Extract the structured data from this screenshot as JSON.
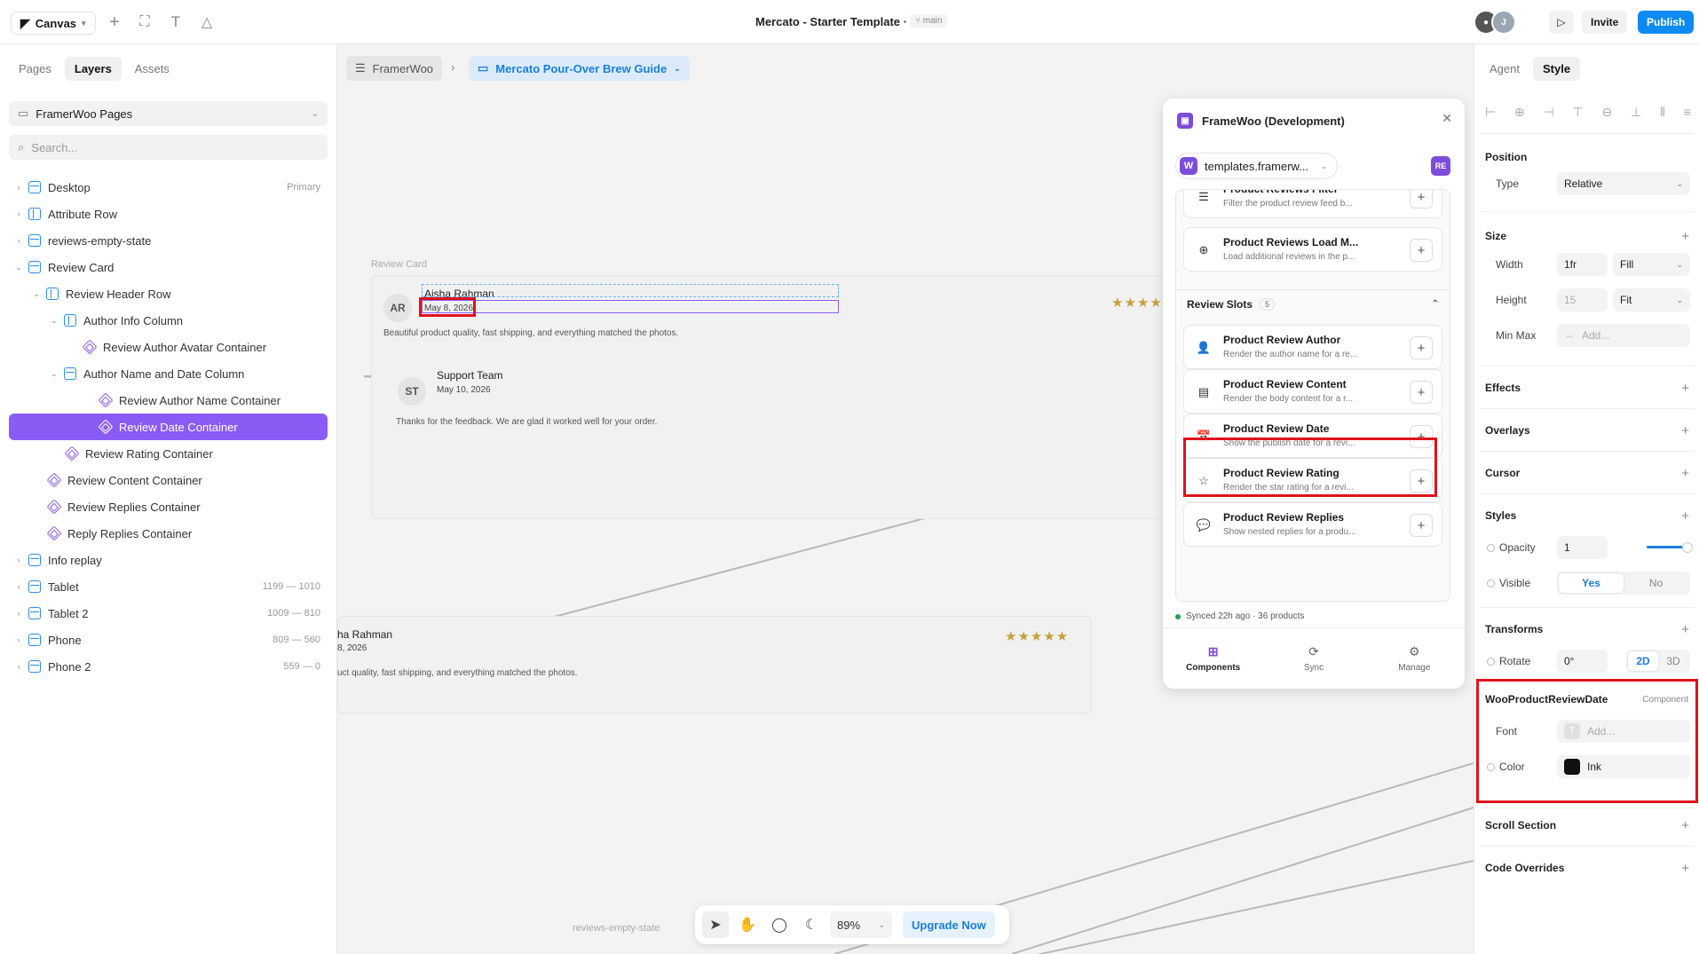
{
  "topbar": {
    "canvas_label": "Canvas",
    "title": "Mercato - Starter Template",
    "separator": "·",
    "branch": "main",
    "avatar_initial": "J",
    "invite_label": "Invite",
    "publish_label": "Publish",
    "colors": {
      "publish": "#0e8bf1"
    }
  },
  "left": {
    "tabs": [
      "Pages",
      "Layers",
      "Assets"
    ],
    "active_tab": "Layers",
    "page_select": "FramerWoo Pages",
    "search_placeholder": "Search...",
    "tree": [
      {
        "label": "Desktop",
        "meta": "Primary",
        "icon": "frame-icon",
        "caret": "›"
      },
      {
        "label": "Attribute Row",
        "meta": "",
        "icon": "column-icon",
        "caret": "›"
      },
      {
        "label": "reviews-empty-state",
        "meta": "",
        "icon": "frame-icon",
        "caret": "›"
      },
      {
        "label": "Review Card",
        "meta": "",
        "icon": "frame-icon",
        "caret": "⌄"
      },
      {
        "label": "Review Header Row",
        "meta": "",
        "icon": "column-icon",
        "caret": "⌄"
      },
      {
        "label": "Author Info Column",
        "meta": "",
        "icon": "column-icon",
        "caret": "⌄"
      },
      {
        "label": "Review Author Avatar Container",
        "meta": "",
        "icon": "component-icon",
        "caret": ""
      },
      {
        "label": "Author Name and Date Column",
        "meta": "",
        "icon": "frame-icon",
        "caret": "⌄"
      },
      {
        "label": "Review Author Name Container",
        "meta": "",
        "icon": "component-icon",
        "caret": ""
      },
      {
        "label": "Review Date Container",
        "meta": "",
        "icon": "component-icon",
        "caret": ""
      },
      {
        "label": "Review Rating Container",
        "meta": "",
        "icon": "component-icon",
        "caret": ""
      },
      {
        "label": "Review Content Container",
        "meta": "",
        "icon": "component-icon",
        "caret": ""
      },
      {
        "label": "Review Replies Container",
        "meta": "",
        "icon": "component-icon",
        "caret": ""
      },
      {
        "label": "Reply Replies Container",
        "meta": "",
        "icon": "component-icon",
        "caret": ""
      },
      {
        "label": "Info replay",
        "meta": "",
        "icon": "frame-icon",
        "caret": "›"
      },
      {
        "label": "Tablet",
        "meta": "1199 — 1010",
        "icon": "frame-icon",
        "caret": "›"
      },
      {
        "label": "Tablet 2",
        "meta": "1009 — 810",
        "icon": "frame-icon",
        "caret": "›"
      },
      {
        "label": "Phone",
        "meta": "809 — 560",
        "icon": "frame-icon",
        "caret": "›"
      },
      {
        "label": "Phone 2",
        "meta": "559 — 0",
        "icon": "frame-icon",
        "caret": "›"
      }
    ],
    "selected_index": 9,
    "colors": {
      "selected": "#8a5cf6",
      "frame": "#2a8df0"
    }
  },
  "canvas": {
    "crumb_root": "FramerWoo",
    "crumb_sep": "›",
    "crumb_page": "Mercato Pour-Over Brew Guide",
    "frame_label_review_card": "Review Card",
    "frame_label_empty": "reviews-empty-state",
    "review1": {
      "avatar": "AR",
      "author": "Aisha Rahman",
      "date": "May 8, 2026",
      "body": "Beautiful product quality, fast shipping, and everything matched the photos.",
      "stars": "★★★★"
    },
    "reply1": {
      "avatar": "ST",
      "author": "Support Team",
      "date": "May 10, 2026",
      "body": "Thanks for the feedback. We are glad it worked well for your order."
    },
    "review2": {
      "author": "ha Rahman",
      "date": "8, 2026",
      "body": "uct quality, fast shipping, and everything matched the photos.",
      "stars": "★★★★★"
    },
    "zoom": "89%",
    "upgrade_label": "Upgrade Now"
  },
  "plugin": {
    "title": "FrameWoo (Development)",
    "logo": "🛒",
    "site": "templates.framerw...",
    "site_icon": "W",
    "user_badge": "RE",
    "top_items": [
      {
        "name": "Product Reviews Filter",
        "desc": "Filter the product review feed b...",
        "icon": "☰"
      },
      {
        "name": "Product Reviews Load M...",
        "desc": "Load additional reviews in the p...",
        "icon": "⊕"
      }
    ],
    "section": {
      "title": "Review Slots",
      "count": "5"
    },
    "slots": [
      {
        "name": "Product Review Author",
        "desc": "Render the author name for a re...",
        "icon": "👤"
      },
      {
        "name": "Product Review Content",
        "desc": "Render the body content for a r...",
        "icon": "▤"
      },
      {
        "name": "Product Review Date",
        "desc": "Show the publish date for a revi...",
        "icon": "📅"
      },
      {
        "name": "Product Review Rating",
        "desc": "Render the star rating for a revi...",
        "icon": "☆"
      },
      {
        "name": "Product Review Replies",
        "desc": "Show nested replies for a produ...",
        "icon": "💬"
      }
    ],
    "sync": "Synced 22h ago · 36 products",
    "tabs": [
      {
        "label": "Components",
        "icon": "⊞"
      },
      {
        "label": "Sync",
        "icon": "⟳"
      },
      {
        "label": "Manage",
        "icon": "⚙"
      }
    ],
    "active_tab": "Components",
    "colors": {
      "brand": "#7c4dda",
      "highlight": "#e0121b"
    }
  },
  "right": {
    "tabs": [
      "Agent",
      "Style"
    ],
    "active_tab": "Style",
    "position": {
      "title": "Position",
      "type_label": "Type",
      "type_value": "Relative"
    },
    "size": {
      "title": "Size",
      "width_label": "Width",
      "width_value": "1fr",
      "width_mode": "Fill",
      "height_label": "Height",
      "height_value": "15",
      "height_mode": "Fit",
      "minmax_label": "Min Max",
      "minmax_placeholder": "Add..."
    },
    "effects": "Effects",
    "overlays": "Overlays",
    "cursor": "Cursor",
    "styles": {
      "title": "Styles",
      "opacity_label": "Opacity",
      "opacity_value": "1",
      "visible_label": "Visible",
      "visible_yes": "Yes",
      "visible_no": "No"
    },
    "transforms": {
      "title": "Transforms",
      "rotate_label": "Rotate",
      "rotate_value": "0°",
      "mode_2d": "2D",
      "mode_3d": "3D"
    },
    "component": {
      "title": "WooProductReviewDate",
      "tag": "Component",
      "font_label": "Font",
      "font_placeholder": "Add...",
      "font_icon": "T",
      "color_label": "Color",
      "color_value": "Ink",
      "color_hex": "#111111"
    },
    "scroll_section": "Scroll Section",
    "code_overrides": "Code Overrides"
  }
}
